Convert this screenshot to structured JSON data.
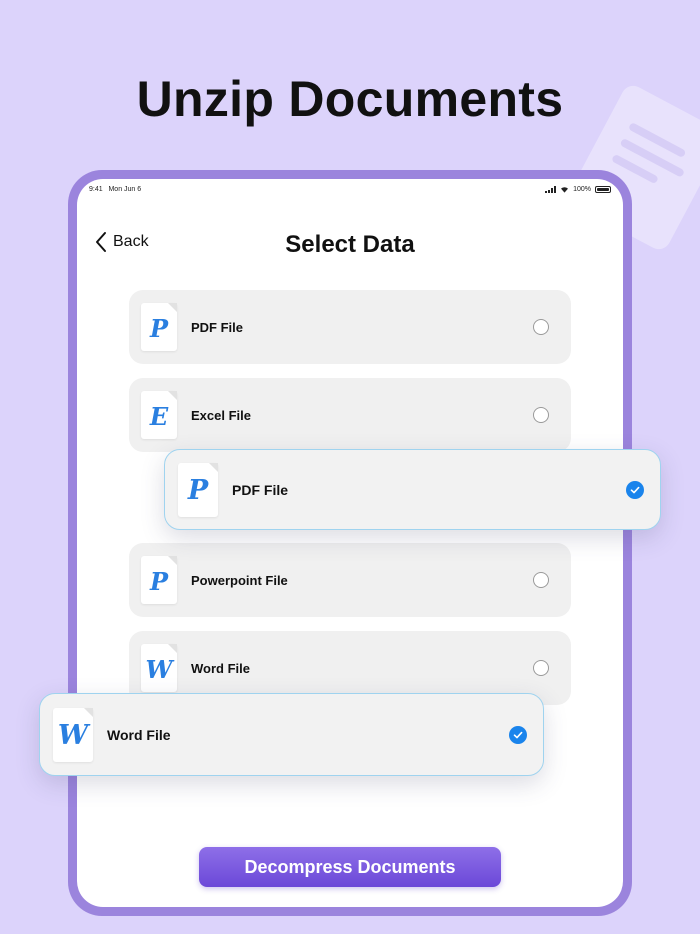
{
  "headline": "Unzip Documents",
  "status_bar": {
    "time": "9:41",
    "date": "Mon Jun 6",
    "battery": "100%"
  },
  "nav": {
    "back_label": "Back",
    "title": "Select Data"
  },
  "rows": [
    {
      "letter": "P",
      "label": "PDF File",
      "selected": false
    },
    {
      "letter": "E",
      "label": "Excel File",
      "selected": false
    },
    {
      "letter": "P",
      "label": "Powerpoint File",
      "selected": false
    },
    {
      "letter": "W",
      "label": "Word File",
      "selected": false
    }
  ],
  "floating_cards": [
    {
      "letter": "P",
      "label": "PDF File",
      "selected": true
    },
    {
      "letter": "W",
      "label": "Word File",
      "selected": true
    }
  ],
  "cta_label": "Decompress Documents",
  "colors": {
    "background": "#dcd3fb",
    "device_frame": "#9b84dd",
    "accent_blue": "#1a84ec",
    "button_purple": "#7755de"
  }
}
